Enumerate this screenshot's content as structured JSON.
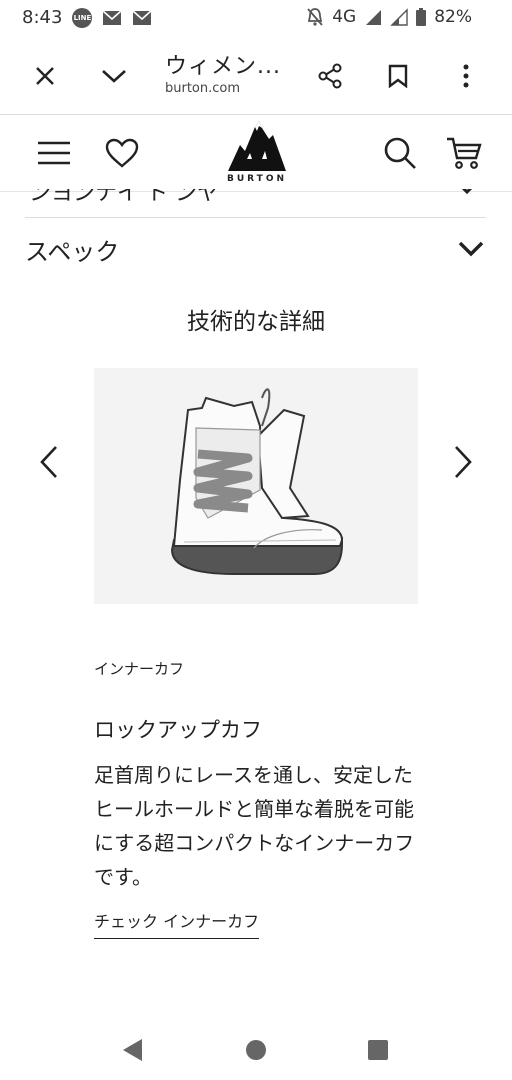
{
  "status_bar": {
    "time": "8:43",
    "network": "4G",
    "battery": "82%",
    "line_badge": "LINE"
  },
  "browser": {
    "title": "ウィメン...",
    "url": "burton.com"
  },
  "header": {
    "logo_text": "BURTON"
  },
  "content": {
    "partial_section": "ンヨンナイ ト ンヤ",
    "spec_title": "スペック",
    "tech_title": "技術的な詳細",
    "feature_label": "インナーカフ",
    "feature_name": "ロックアップカフ",
    "feature_desc": "足首周りにレースを通し、安定したヒールホールドと簡単な着脱を可能にする超コンパクトなインナーカフです。",
    "feature_link": "チェック インナーカフ"
  },
  "colors": {
    "image_bg": "#f3f3f3",
    "lace_gray": "#888888",
    "sole_dark": "#555555"
  }
}
